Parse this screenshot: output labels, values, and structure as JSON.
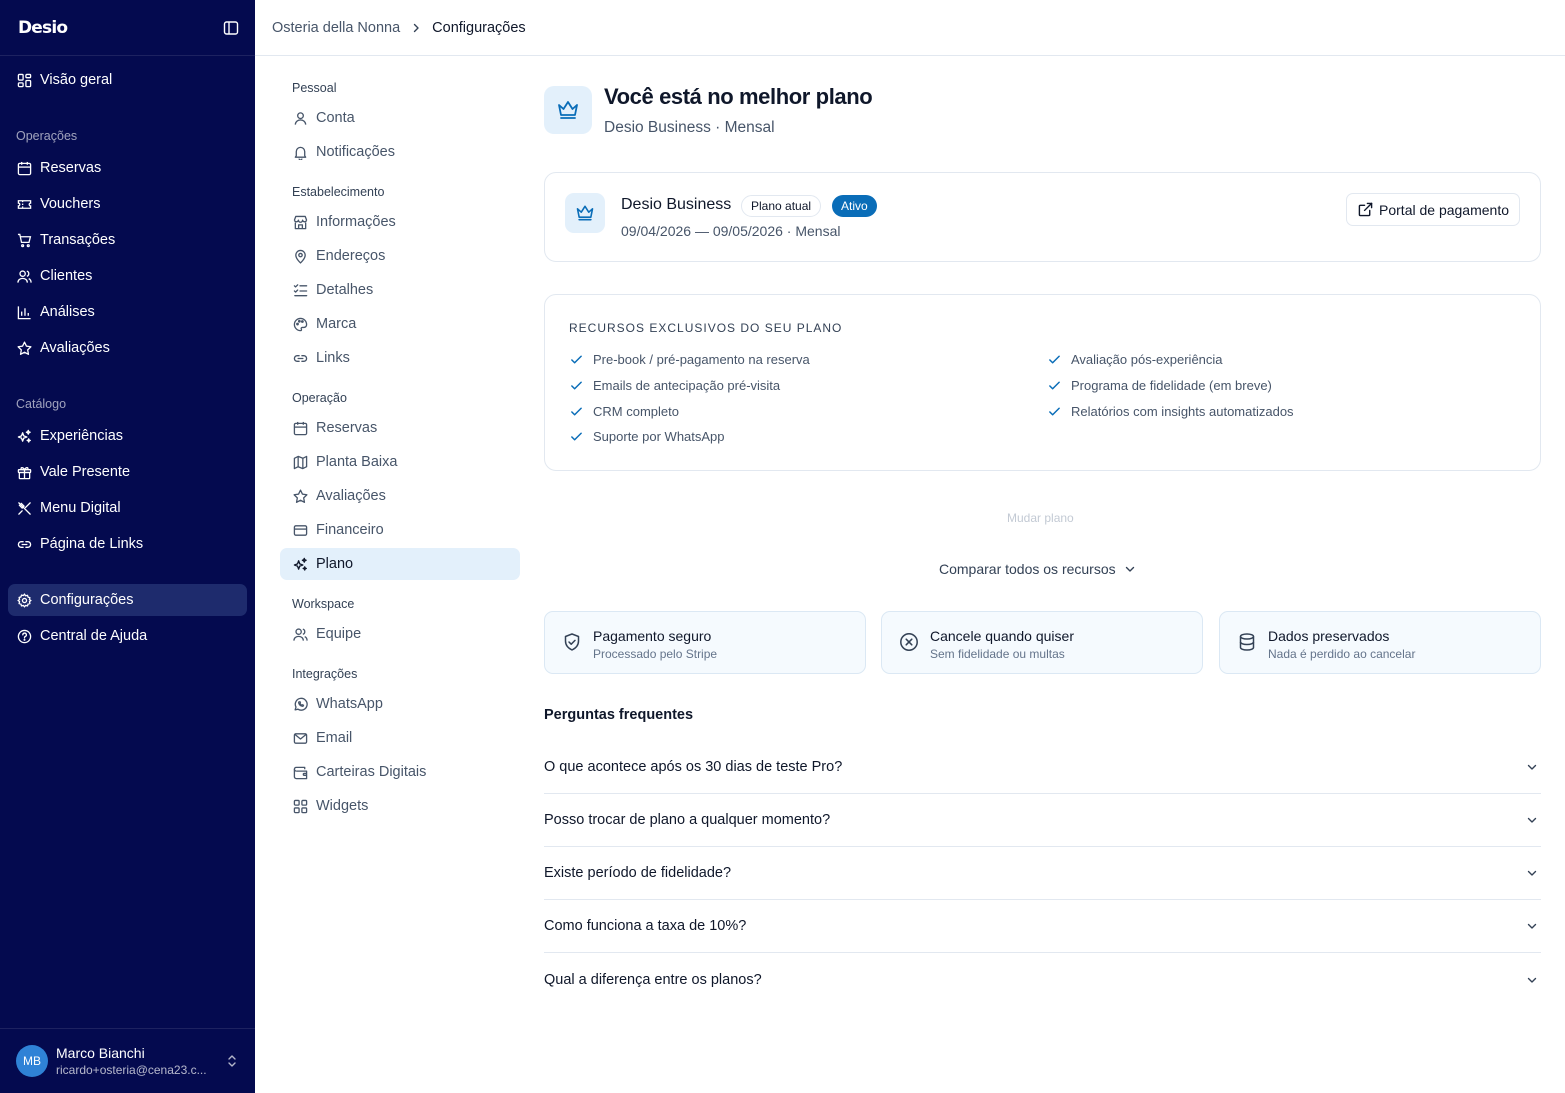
{
  "colors": {
    "sidebar_bg": "#040a4f",
    "sidebar_active": "#1e2b6d",
    "accent": "#0a6db8",
    "soft_accent": "#e3f0fb"
  },
  "sidebar": {
    "logo": "Desio",
    "items": [
      {
        "label": "Visão geral",
        "icon": "dashboard-icon"
      },
      {
        "label": "Reservas",
        "icon": "calendar-icon"
      },
      {
        "label": "Vouchers",
        "icon": "ticket-icon"
      },
      {
        "label": "Transações",
        "icon": "cart-icon"
      },
      {
        "label": "Clientes",
        "icon": "users-icon"
      },
      {
        "label": "Análises",
        "icon": "bar-chart-icon"
      },
      {
        "label": "Avaliações",
        "icon": "star-icon"
      },
      {
        "label": "Experiências",
        "icon": "sparkles-icon"
      },
      {
        "label": "Vale Presente",
        "icon": "gift-icon"
      },
      {
        "label": "Menu Digital",
        "icon": "utensils-icon"
      },
      {
        "label": "Página de Links",
        "icon": "link-icon"
      },
      {
        "label": "Configurações",
        "icon": "gear-icon",
        "active": true
      },
      {
        "label": "Central de Ajuda",
        "icon": "help-icon"
      }
    ],
    "sections": {
      "operacoes": "Operações",
      "catalogo": "Catálogo"
    },
    "user": {
      "initials": "MB",
      "name": "Marco Bianchi",
      "email": "ricardo+osteria@cena23.c..."
    }
  },
  "breadcrumb": {
    "parent": "Osteria della Nonna",
    "current": "Configurações"
  },
  "settings_nav": {
    "sections": {
      "pessoal": "Pessoal",
      "estabelecimento": "Estabelecimento",
      "operacao": "Operação",
      "workspace": "Workspace",
      "integracoes": "Integrações"
    },
    "items": [
      {
        "label": "Conta",
        "icon": "user-icon"
      },
      {
        "label": "Notificações",
        "icon": "bell-icon"
      },
      {
        "label": "Informações",
        "icon": "store-icon"
      },
      {
        "label": "Endereços",
        "icon": "map-pin-icon"
      },
      {
        "label": "Detalhes",
        "icon": "list-check-icon"
      },
      {
        "label": "Marca",
        "icon": "palette-icon"
      },
      {
        "label": "Links",
        "icon": "link-icon"
      },
      {
        "label": "Reservas",
        "icon": "calendar-icon"
      },
      {
        "label": "Planta Baixa",
        "icon": "map-icon"
      },
      {
        "label": "Avaliações",
        "icon": "star-icon"
      },
      {
        "label": "Financeiro",
        "icon": "credit-card-icon"
      },
      {
        "label": "Plano",
        "icon": "sparkles-icon",
        "active": true
      },
      {
        "label": "Equipe",
        "icon": "users-icon"
      },
      {
        "label": "WhatsApp",
        "icon": "whatsapp-icon"
      },
      {
        "label": "Email",
        "icon": "mail-icon"
      },
      {
        "label": "Carteiras Digitais",
        "icon": "wallet-icon"
      },
      {
        "label": "Widgets",
        "icon": "grid-icon"
      }
    ]
  },
  "hero": {
    "title": "Você está no melhor plano",
    "subtitle": "Desio Business · Mensal"
  },
  "plan_card": {
    "name": "Desio Business",
    "badge_current": "Plano atual",
    "badge_status": "Ativo",
    "dates": "09/04/2026 — 09/05/2026 · Mensal",
    "portal_button": "Portal de pagamento"
  },
  "features": {
    "title": "RECURSOS EXCLUSIVOS DO SEU PLANO",
    "left": [
      "Pre-book / pré-pagamento na reserva",
      "Emails de antecipação pré-visita",
      "CRM completo",
      "Suporte por WhatsApp"
    ],
    "right": [
      "Avaliação pós-experiência",
      "Programa de fidelidade (em breve)",
      "Relatórios com insights automatizados"
    ]
  },
  "change_plan": "Mudar plano",
  "compare": "Comparar todos os recursos",
  "assurances": [
    {
      "title": "Pagamento seguro",
      "subtitle": "Processado pelo Stripe",
      "icon": "shield-check-icon"
    },
    {
      "title": "Cancele quando quiser",
      "subtitle": "Sem fidelidade ou multas",
      "icon": "x-circle-icon"
    },
    {
      "title": "Dados preservados",
      "subtitle": "Nada é perdido ao cancelar",
      "icon": "database-icon"
    }
  ],
  "faq": {
    "title": "Perguntas frequentes",
    "items": [
      "O que acontece após os 30 dias de teste Pro?",
      "Posso trocar de plano a qualquer momento?",
      "Existe período de fidelidade?",
      "Como funciona a taxa de 10%?",
      "Qual a diferença entre os planos?"
    ]
  }
}
